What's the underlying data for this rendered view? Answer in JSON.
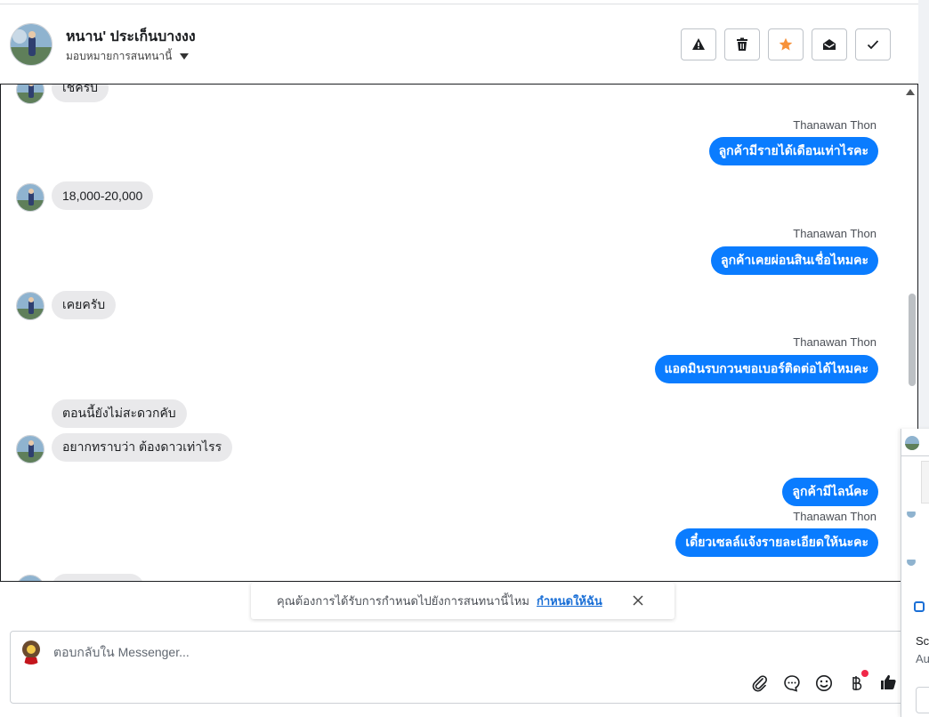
{
  "header": {
    "contact_name": "หนาน' ประเก็นบางงง",
    "assign_label": "มอบหมายการสนทนานี้"
  },
  "actions": [
    "warning-icon",
    "trash-icon",
    "star-icon",
    "mark-unread-icon",
    "done-icon"
  ],
  "messages": {
    "m0": "เช็ครับ",
    "s1": "Thanawan Thon",
    "m1": "ลูกค้ามีรายได้เดือนเท่าไรคะ",
    "m2": "18,000-20,000",
    "s2": "Thanawan Thon",
    "m3": "ลูกค้าเคยผ่อนสินเชื่อไหมคะ",
    "m4": "เคยครับ",
    "s3": "Thanawan Thon",
    "m5": "แอดมินรบกวนขอเบอร์ติดต่อได้ไหมคะ",
    "m6": "ตอนนี้ยังไม่สะดวกคับ",
    "m7": "อยากทราบว่า ต้องดาวเท่าไรร",
    "m8": "ลูกค้ามีไลน์คะ",
    "s4": "Thanawan Thon",
    "m9": "เดี๋ยวเซลล์แจ้งรายละเอียดให้นะคะ"
  },
  "notice": {
    "text": "คุณต้องการได้รับการกำหนดไปยังการสนทนานี้ไหม",
    "link": "กำหนดให้ฉัน"
  },
  "composer": {
    "placeholder": "ตอบกลับใน Messenger..."
  },
  "preview": {
    "line1": "Scr",
    "line2": "Au"
  },
  "colors": {
    "accent": "#0a7cff",
    "incoming_bubble": "#e9e9eb",
    "star": "#f7923a",
    "link": "#1a6fd6",
    "badge": "#f02849"
  }
}
